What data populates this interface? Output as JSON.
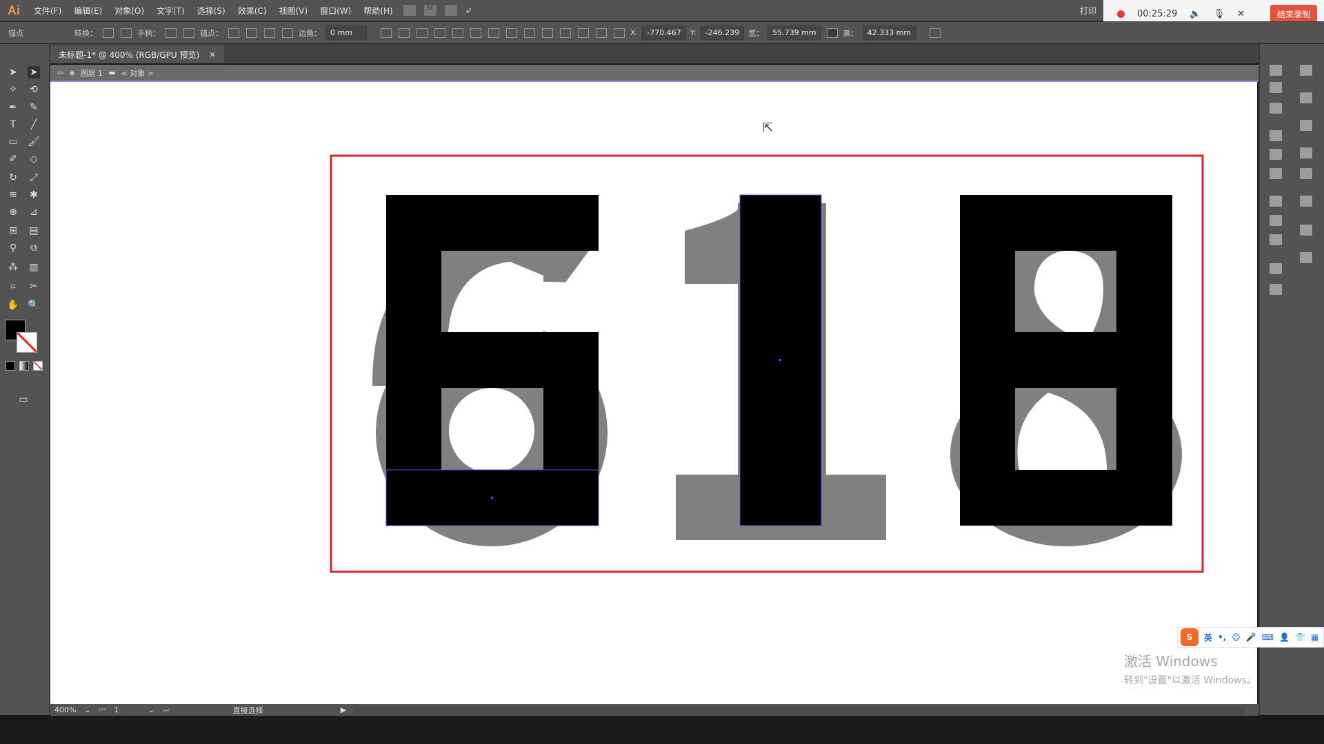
{
  "app": {
    "logo": "Ai"
  },
  "menu": [
    "文件(F)",
    "编辑(E)",
    "对象(O)",
    "文字(T)",
    "选择(S)",
    "效果(C)",
    "视图(V)",
    "窗口(W)",
    "帮助(H)"
  ],
  "menu_extra": {
    "st": "St",
    "print": "打印"
  },
  "control": {
    "mode": "锚点",
    "convert": "转换：",
    "handles": "手柄：",
    "anchors": "锚点：",
    "corner": "边角：",
    "corner_value": "0 mm",
    "x_label": "X:",
    "x": "-770.467",
    "y_label": "Y:",
    "y": "-246.239",
    "w_label": "宽：",
    "w": "55.739 mm",
    "h_label": "高：",
    "h": "42.333 mm"
  },
  "document": {
    "tab": "未标题-1* @ 400% (RGB/GPU 预览)",
    "close": "×"
  },
  "breadcrumb": {
    "layer": "图层 1",
    "object": "< 对象 >"
  },
  "status": {
    "zoom": "400%",
    "artboard": "1",
    "tool": "直接选择"
  },
  "recorder": {
    "time": "00:25:29",
    "stop": "结束录制",
    "recording_color": "#e53935"
  },
  "ime": {
    "logo": "S",
    "lang": "英",
    "punct": "•,"
  },
  "windows": {
    "line1": "激活 Windows",
    "line2": "转到\"设置\"以激活 Windows。"
  },
  "artwork": {
    "frame_color": "#d6262b",
    "fill_front": "#000000",
    "fill_back": "#808080",
    "selection_color": "#4b5bd6"
  }
}
